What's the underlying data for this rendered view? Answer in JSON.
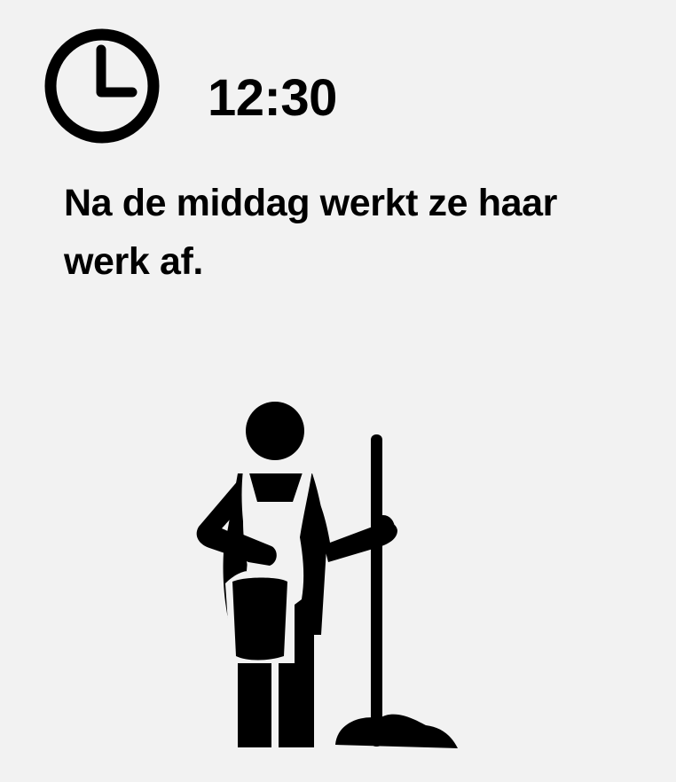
{
  "clock": {
    "icon": "clock-icon",
    "time": "12:30"
  },
  "caption": "Na de middag werkt ze haar werk af.",
  "illustration": {
    "icon": "cleaning-lady-with-mop-icon",
    "color": "#000000"
  },
  "colors": {
    "background": "#f2f2f2",
    "text": "#000000"
  }
}
